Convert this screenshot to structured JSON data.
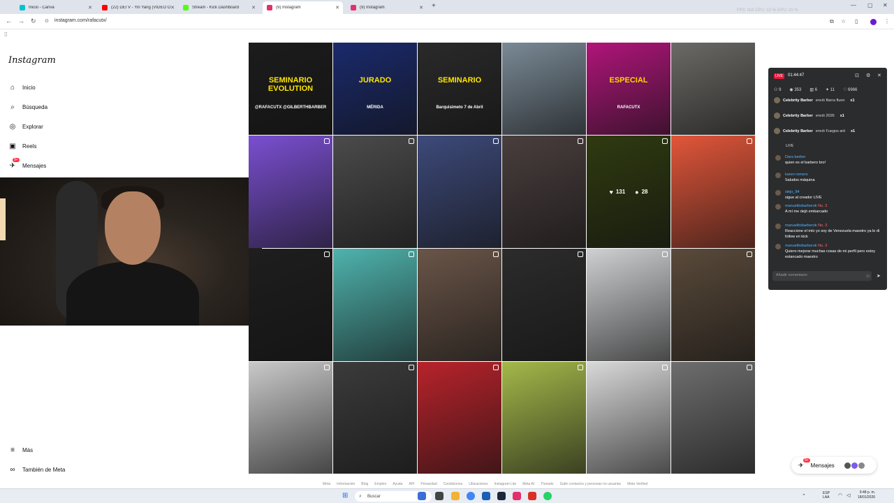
{
  "browser": {
    "tabs": [
      {
        "label": "Inicio - Canva",
        "color": "#00c4cc",
        "active": false
      },
      {
        "label": "(22) DEI V - Yin Yang (VIDEO O",
        "color": "#ff0000",
        "active": false
      },
      {
        "label": "Stream - Kick Dashboard",
        "color": "#53fc18",
        "active": false
      },
      {
        "label": "(9) Instagram",
        "color": "#e1306c",
        "active": true
      },
      {
        "label": "(9) Instagram",
        "color": "#e1306c",
        "active": false
      }
    ],
    "new_tab": "+",
    "url": "instagram.com/rafacutx/",
    "perf_overlay": "FPS: N/A    CPU: 13 %    GPU: 20 %"
  },
  "instagram": {
    "logo": "Instagram",
    "nav": [
      {
        "label": "Inicio",
        "icon": "home-icon"
      },
      {
        "label": "Búsqueda",
        "icon": "search-icon"
      },
      {
        "label": "Explorar",
        "icon": "compass-icon"
      },
      {
        "label": "Reels",
        "icon": "reels-icon"
      },
      {
        "label": "Mensajes",
        "icon": "messenger-icon",
        "badge": "9+"
      }
    ],
    "nav_bottom": [
      {
        "label": "Más",
        "icon": "menu-icon"
      },
      {
        "label": "También de Meta",
        "icon": "meta-icon"
      }
    ],
    "posts": [
      {
        "bg": "#1c1c1c",
        "text": "SEMINARIO EVOLUTION",
        "sub": "@RAFACUTX   @GILBERTHBARBER"
      },
      {
        "bg": "#1a2a6c",
        "text": "JURADO",
        "sub": "MÉRIDA"
      },
      {
        "bg": "#2a2a2a",
        "text": "SEMINARIO",
        "sub": "Barquisimeto 7 de Abril"
      },
      {
        "bg": "#7a8a96",
        "text": "",
        "sub": ""
      },
      {
        "bg": "#b0157a",
        "text": "ESPECIAL",
        "sub": "RAFACUTX"
      },
      {
        "bg": "#6b6a66",
        "text": "",
        "sub": ""
      },
      {
        "bg": "#7a4fd0",
        "text": "",
        "sub": ""
      },
      {
        "bg": "#4b4b4b",
        "text": "",
        "sub": ""
      },
      {
        "bg": "#3d4a7a",
        "text": "",
        "sub": ""
      },
      {
        "bg": "#4a3e3e",
        "text": "",
        "sub": ""
      },
      {
        "bg": "#2f3a10",
        "text": "",
        "sub": "",
        "likes": "131",
        "comments": "28"
      },
      {
        "bg": "#e2563a",
        "text": "",
        "sub": ""
      },
      {
        "bg": "#1e1e1e",
        "text": "",
        "sub": ""
      },
      {
        "bg": "#4fb3ad",
        "text": "",
        "sub": ""
      },
      {
        "bg": "#6a5548",
        "text": "",
        "sub": ""
      },
      {
        "bg": "#2c2c2c",
        "text": "",
        "sub": ""
      },
      {
        "bg": "#cfd0d2",
        "text": "",
        "sub": ""
      },
      {
        "bg": "#5a4a3a",
        "text": "",
        "sub": ""
      },
      {
        "bg": "#c9c9c9",
        "text": "",
        "sub": ""
      },
      {
        "bg": "#3b3b3b",
        "text": "",
        "sub": ""
      },
      {
        "bg": "#b8232b",
        "text": "",
        "sub": ""
      },
      {
        "bg": "#a4b84a",
        "text": "",
        "sub": ""
      },
      {
        "bg": "#d9d9d9",
        "text": "",
        "sub": ""
      },
      {
        "bg": "#6e6e6e",
        "text": "",
        "sub": ""
      }
    ],
    "footer_links": [
      "Meta",
      "Información",
      "Blog",
      "Empleo",
      "Ayuda",
      "API",
      "Privacidad",
      "Condiciones",
      "Ubicaciones",
      "Instagram Lite",
      "Meta AI",
      "Threads",
      "Subir contactos y personas no usuarias",
      "Meta Verified"
    ],
    "messages_float": "Mensajes",
    "messages_badge": "9+"
  },
  "kick_chat": {
    "live": "LIVE",
    "time": "01:44:47",
    "stats": [
      "9",
      "353",
      "6",
      "11",
      "6966"
    ],
    "gifts": [
      {
        "user": "Celebrity Barber",
        "text": "envió Barra fluon",
        "mult": "x1"
      },
      {
        "user": "Celebrity Barber",
        "text": "envió 2026",
        "mult": "x1"
      },
      {
        "user": "Celebrity Barber",
        "text": "envió Fuegos arti",
        "mult": "x1"
      }
    ],
    "section": "LIVE",
    "messages": [
      {
        "user": "Dara barber",
        "lvl": "",
        "text": "quien es el barbero bro!"
      },
      {
        "user": "karen romero",
        "lvl": "",
        "text": "Saludos máquina"
      },
      {
        "user": "slejo_94",
        "lvl": "",
        "text": "sigue al creador LIVE"
      },
      {
        "user": "manuelitobarberok",
        "lvl": "No. 3",
        "text": "A mí me dejó embarcado"
      },
      {
        "user": "manuelitobarberok",
        "lvl": "No. 3",
        "text": "Reaccione el mío yo soy de Venezuela maestro ya le di follow en kick"
      },
      {
        "user": "manuelitobarberok",
        "lvl": "No. 3",
        "text": "Quiero mejorar muchas cosas de mi perfil pero estoy estancado maestro"
      }
    ],
    "input_placeholder": "Añadir comentario"
  },
  "taskbar": {
    "search": "Buscar",
    "lang": "ESP LAA",
    "time": "9:48 p. m.",
    "date": "18/01/2026"
  }
}
